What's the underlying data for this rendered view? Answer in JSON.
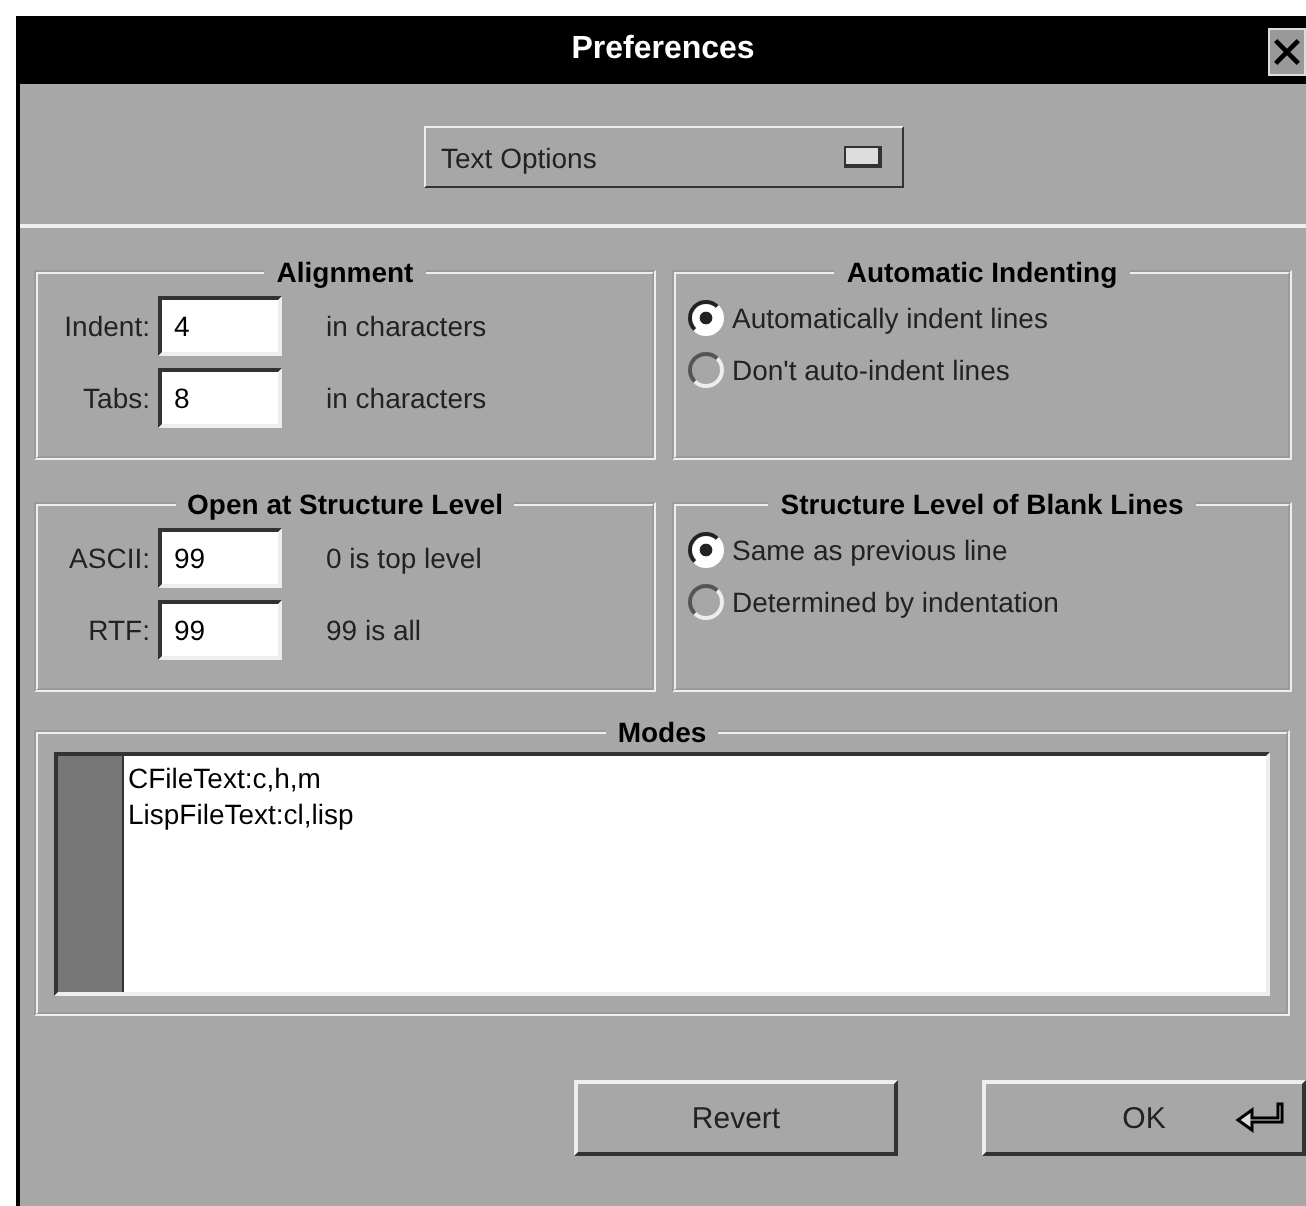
{
  "window": {
    "title": "Preferences"
  },
  "category_menu": {
    "value": "Text Options"
  },
  "groups": [
    {
      "title": "Alignment",
      "kind": "fields",
      "rows": [
        {
          "label": "Indent:",
          "value": "4",
          "hint": "in characters"
        },
        {
          "label": "Tabs:",
          "value": "8",
          "hint": "in characters"
        }
      ]
    },
    {
      "title": "Automatic Indenting",
      "kind": "radios",
      "options": [
        {
          "label": "Automatically indent lines",
          "selected": true
        },
        {
          "label": "Don't auto-indent lines",
          "selected": false
        }
      ]
    },
    {
      "title": "Open at Structure Level",
      "kind": "fields",
      "rows": [
        {
          "label": "ASCII:",
          "value": "99",
          "hint": "0 is top level"
        },
        {
          "label": "RTF:",
          "value": "99",
          "hint": "99 is all"
        }
      ]
    },
    {
      "title": "Structure Level of Blank Lines",
      "kind": "radios",
      "options": [
        {
          "label": "Same as previous line",
          "selected": true
        },
        {
          "label": "Determined by indentation",
          "selected": false
        }
      ]
    }
  ],
  "modes": {
    "title": "Modes",
    "items": [
      "CFileText:c,h,m",
      "LispFileText:cl,lisp"
    ]
  },
  "buttons": [
    {
      "label": "Revert",
      "kind": "plain"
    },
    {
      "label": "OK",
      "kind": "default"
    }
  ]
}
